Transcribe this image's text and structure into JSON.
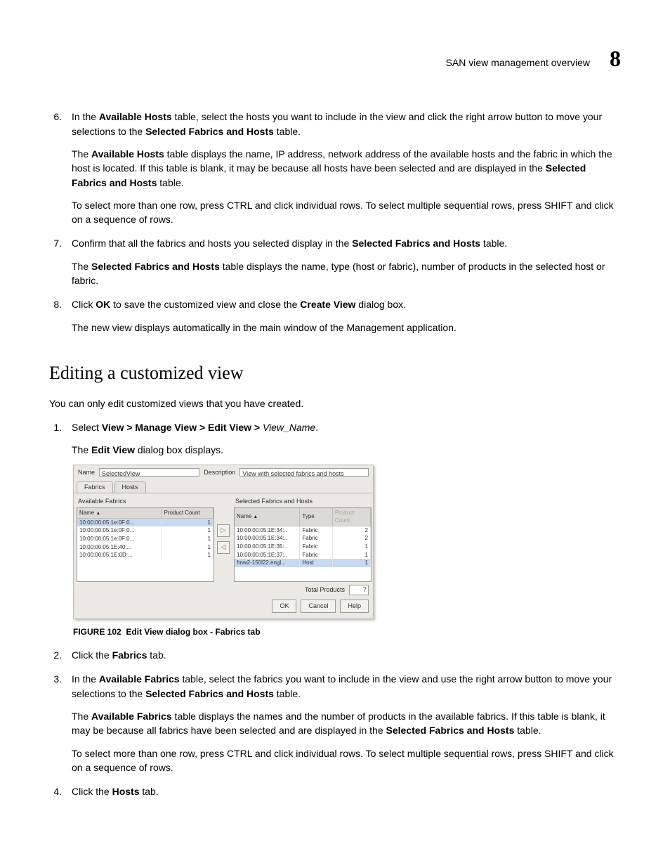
{
  "header": {
    "running_title": "SAN view management overview",
    "chapter_number": "8"
  },
  "steps_a": [
    {
      "num": "6.",
      "runs": [
        {
          "t": "In the "
        },
        {
          "t": "Available Hosts",
          "b": true
        },
        {
          "t": " table, select the hosts you want to include in the view and click the right arrow button to move your selections to the "
        },
        {
          "t": "Selected Fabrics and Hosts",
          "b": true
        },
        {
          "t": " table."
        }
      ],
      "paras": [
        [
          {
            "t": "The "
          },
          {
            "t": "Available Hosts",
            "b": true
          },
          {
            "t": " table displays the name, IP address, network address of the available hosts and the fabric in which the host is located. If this table is blank, it may be because all hosts have been selected and are displayed in the "
          },
          {
            "t": "Selected Fabrics and Hosts",
            "b": true
          },
          {
            "t": " table."
          }
        ],
        [
          {
            "t": "To select more than one row, press CTRL and click individual rows. To select multiple sequential rows, press SHIFT and click on a sequence of rows."
          }
        ]
      ]
    },
    {
      "num": "7.",
      "runs": [
        {
          "t": "Confirm that all the fabrics and hosts you selected display in the "
        },
        {
          "t": "Selected Fabrics and Hosts",
          "b": true
        },
        {
          "t": " table."
        }
      ],
      "paras": [
        [
          {
            "t": "The "
          },
          {
            "t": "Selected Fabrics and Hosts",
            "b": true
          },
          {
            "t": " table displays the name, type (host or fabric), number of products in the selected host or fabric."
          }
        ]
      ]
    },
    {
      "num": "8.",
      "runs": [
        {
          "t": "Click "
        },
        {
          "t": "OK",
          "b": true
        },
        {
          "t": " to save the customized view and close the "
        },
        {
          "t": "Create View",
          "b": true
        },
        {
          "t": " dialog box."
        }
      ],
      "paras": [
        [
          {
            "t": "The new view displays automatically in the main window of the Management application."
          }
        ]
      ]
    }
  ],
  "section_heading": "Editing a customized view",
  "section_intro": "You can only edit customized views that you have created.",
  "steps_b_pre": [
    {
      "num": "1.",
      "runs": [
        {
          "t": "Select "
        },
        {
          "t": "View > Manage View > Edit View > ",
          "b": true
        },
        {
          "t": "View_Name",
          "i": true
        },
        {
          "t": "."
        }
      ],
      "paras": [
        [
          {
            "t": "The "
          },
          {
            "t": "Edit View",
            "b": true
          },
          {
            "t": " dialog box displays."
          }
        ]
      ]
    }
  ],
  "dialog": {
    "name_label": "Name",
    "name_value": "SelectedView",
    "desc_label": "Description",
    "desc_value": "View with selected fabrics and hosts",
    "tabs": {
      "fabrics": "Fabrics",
      "hosts": "Hosts"
    },
    "left_panel": {
      "title": "Available Fabrics",
      "columns": [
        "Name",
        "Product Count"
      ],
      "rows": [
        {
          "name": "10:00:00:05:1e:0F:0...",
          "count": "1",
          "selected": true
        },
        {
          "name": "10:00:00:05:1e:0F:0...",
          "count": "1"
        },
        {
          "name": "10:00:00:05:1e:0F:0...",
          "count": "1"
        },
        {
          "name": "10:00:00:05:1E:40:...",
          "count": "1"
        },
        {
          "name": "10:00:00:05:1E:0D:...",
          "count": "1"
        }
      ]
    },
    "right_panel": {
      "title": "Selected Fabrics and Hosts",
      "columns": [
        "Name",
        "Type",
        "Product Count"
      ],
      "rows": [
        {
          "name": "10:00:00:05:1E:34:..",
          "type": "Fabric",
          "count": "2"
        },
        {
          "name": "10:00:00:05:1E:34:..",
          "type": "Fabric",
          "count": "2"
        },
        {
          "name": "10:00:00:05:1E:35:..",
          "type": "Fabric",
          "count": "1"
        },
        {
          "name": "10:00:00:05:1E:37:..",
          "type": "Fabric",
          "count": "1"
        },
        {
          "name": "fmw2-150l22.engl...",
          "type": "Host",
          "count": "1",
          "selected": true
        }
      ]
    },
    "total_label": "Total Products",
    "total_value": "7",
    "buttons": {
      "ok": "OK",
      "cancel": "Cancel",
      "help": "Help"
    }
  },
  "figure_caption": {
    "label": "FIGURE 102",
    "text": "Edit View dialog box - Fabrics tab"
  },
  "steps_b_post": [
    {
      "num": "2.",
      "runs": [
        {
          "t": "Click the "
        },
        {
          "t": "Fabrics",
          "b": true
        },
        {
          "t": " tab."
        }
      ],
      "paras": []
    },
    {
      "num": "3.",
      "runs": [
        {
          "t": "In the "
        },
        {
          "t": "Available Fabrics",
          "b": true
        },
        {
          "t": " table, select the fabrics you want to include in the view and use the right arrow button to move your selections to the "
        },
        {
          "t": "Selected Fabrics and Hosts",
          "b": true
        },
        {
          "t": " table."
        }
      ],
      "paras": [
        [
          {
            "t": "The "
          },
          {
            "t": "Available Fabrics",
            "b": true
          },
          {
            "t": " table displays the names and the number of products in the available fabrics. If this table is blank, it may be because all fabrics have been selected and are displayed in the "
          },
          {
            "t": "Selected Fabrics and Hosts",
            "b": true
          },
          {
            "t": " table."
          }
        ],
        [
          {
            "t": "To select more than one row, press CTRL and click individual rows. To select multiple sequential rows, press SHIFT and click on a sequence of rows."
          }
        ]
      ]
    },
    {
      "num": "4.",
      "runs": [
        {
          "t": "Click the "
        },
        {
          "t": "Hosts",
          "b": true
        },
        {
          "t": " tab."
        }
      ],
      "paras": []
    }
  ]
}
